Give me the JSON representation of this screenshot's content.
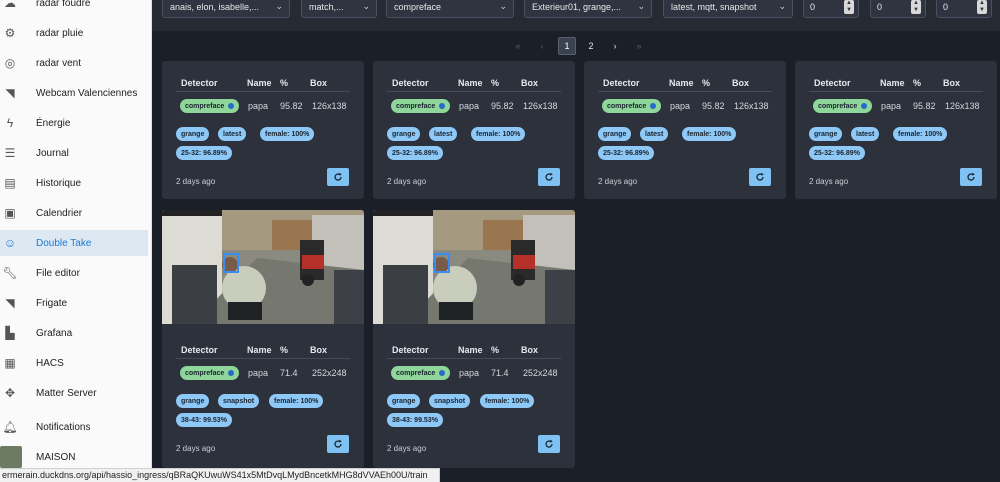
{
  "sidebar": {
    "items": [
      {
        "label": "radar foudre",
        "icon": "cloud-lightning-icon"
      },
      {
        "label": "radar pluie",
        "icon": "gear-icon"
      },
      {
        "label": "radar vent",
        "icon": "radar-icon"
      },
      {
        "label": "Webcam Valenciennes",
        "icon": "cctv-icon"
      },
      {
        "label": "Énergie",
        "icon": "lightning-icon"
      },
      {
        "label": "Journal",
        "icon": "list-icon"
      },
      {
        "label": "Historique",
        "icon": "chart-icon"
      },
      {
        "label": "Calendrier",
        "icon": "calendar-icon"
      },
      {
        "label": "Double Take",
        "icon": "face-icon",
        "active": true
      },
      {
        "label": "File editor",
        "icon": "wrench-icon"
      },
      {
        "label": "Frigate",
        "icon": "cctv-icon"
      },
      {
        "label": "Grafana",
        "icon": "grafana-icon"
      },
      {
        "label": "HACS",
        "icon": "store-icon"
      },
      {
        "label": "Matter Server",
        "icon": "puzzle-icon"
      },
      {
        "label": "Notifications",
        "icon": "bell-icon"
      },
      {
        "label": "MAISON",
        "icon": "avatar"
      }
    ]
  },
  "filters": {
    "names": "anais, elon, isabelle,...",
    "match": "match,...",
    "detector": "compreface",
    "cameras": "Exterieur01, grange,...",
    "types": "latest, mqtt, snapshot",
    "num1": "0",
    "num2": "0",
    "num3": "0"
  },
  "pagination": {
    "first": "«",
    "prev": "‹",
    "pages": [
      "1",
      "2"
    ],
    "next": "›",
    "last": "»"
  },
  "table_headers": {
    "detector": "Detector",
    "name": "Name",
    "percent": "%",
    "box": "Box"
  },
  "cards": [
    {
      "detector": "compreface",
      "name": "papa",
      "percent": "95.82",
      "box": "126x138",
      "tags": [
        "grange",
        "latest",
        "female: 100%"
      ],
      "age": "25-32: 96.89%",
      "time": "2 days ago",
      "image": false
    },
    {
      "detector": "compreface",
      "name": "papa",
      "percent": "95.82",
      "box": "126x138",
      "tags": [
        "grange",
        "latest",
        "female: 100%"
      ],
      "age": "25-32: 96.89%",
      "time": "2 days ago",
      "image": false
    },
    {
      "detector": "compreface",
      "name": "papa",
      "percent": "95.82",
      "box": "126x138",
      "tags": [
        "grange",
        "latest",
        "female: 100%"
      ],
      "age": "25-32: 96.89%",
      "time": "2 days ago",
      "image": false
    },
    {
      "detector": "compreface",
      "name": "papa",
      "percent": "95.82",
      "box": "126x138",
      "tags": [
        "grange",
        "latest",
        "female: 100%"
      ],
      "age": "25-32: 96.89%",
      "time": "2 days ago",
      "image": false
    },
    {
      "detector": "compreface",
      "name": "papa",
      "percent": "71.4",
      "box": "252x248",
      "tags": [
        "grange",
        "snapshot",
        "female: 100%"
      ],
      "age": "38-43: 99.53%",
      "time": "2 days ago",
      "image": true
    },
    {
      "detector": "compreface",
      "name": "papa",
      "percent": "71.4",
      "box": "252x248",
      "tags": [
        "grange",
        "snapshot",
        "female: 100%"
      ],
      "age": "38-43: 99.53%",
      "time": "2 days ago",
      "image": true
    }
  ],
  "status_url": "ermerain.duckdns.org/api/hassio_ingress/qBRaQKUwuWS41x5MtDvqLMydBncetkMHG8dVVAEh00U/train"
}
